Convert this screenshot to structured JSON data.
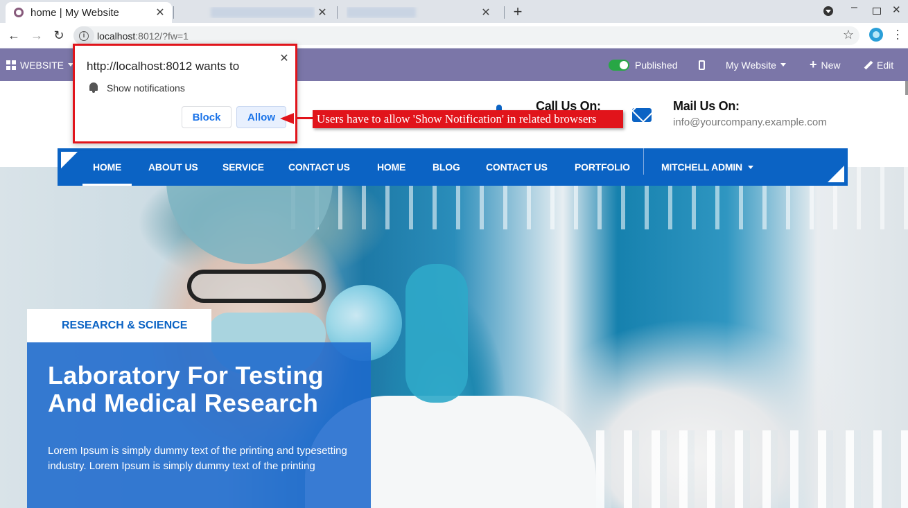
{
  "browser": {
    "active_tab_title": "home | My Website",
    "url_host": "localhost",
    "url_rest": ":8012/?fw=1",
    "new_tab": "+",
    "close_glyph": "✕"
  },
  "admin_bar": {
    "app_menu_label": "WEBSITE",
    "published_label": "Published",
    "website_selector": "My Website",
    "new_label": "New",
    "edit_label": "Edit"
  },
  "header": {
    "call_title": "Call Us On:",
    "mail_title": "Mail Us On:",
    "mail_value": "info@yourcompany.example.com"
  },
  "nav": {
    "items": [
      "HOME",
      "ABOUT US",
      "SERVICE",
      "CONTACT US",
      "HOME",
      "BLOG",
      "CONTACT US",
      "PORTFOLIO"
    ],
    "user_menu": "MITCHELL ADMIN"
  },
  "hero": {
    "tag": "RESEARCH & SCIENCE",
    "title_line1": "Laboratory For Testing",
    "title_line2": "And Medical Research",
    "text": "Lorem Ipsum is simply dummy text of the printing and typesetting industry. Lorem Ipsum is simply dummy text of the printing"
  },
  "permission_prompt": {
    "title": "http://localhost:8012 wants to",
    "item": "Show notifications",
    "block_label": "Block",
    "allow_label": "Allow",
    "close_glyph": "✕"
  },
  "annotation": {
    "text": "Users have to allow 'Show Notification' in related browsers"
  },
  "colors": {
    "admin_bar": "#7b76a8",
    "brand_blue": "#0b63c4",
    "annotation_red": "#e1141b",
    "published_toggle": "#28a745"
  }
}
